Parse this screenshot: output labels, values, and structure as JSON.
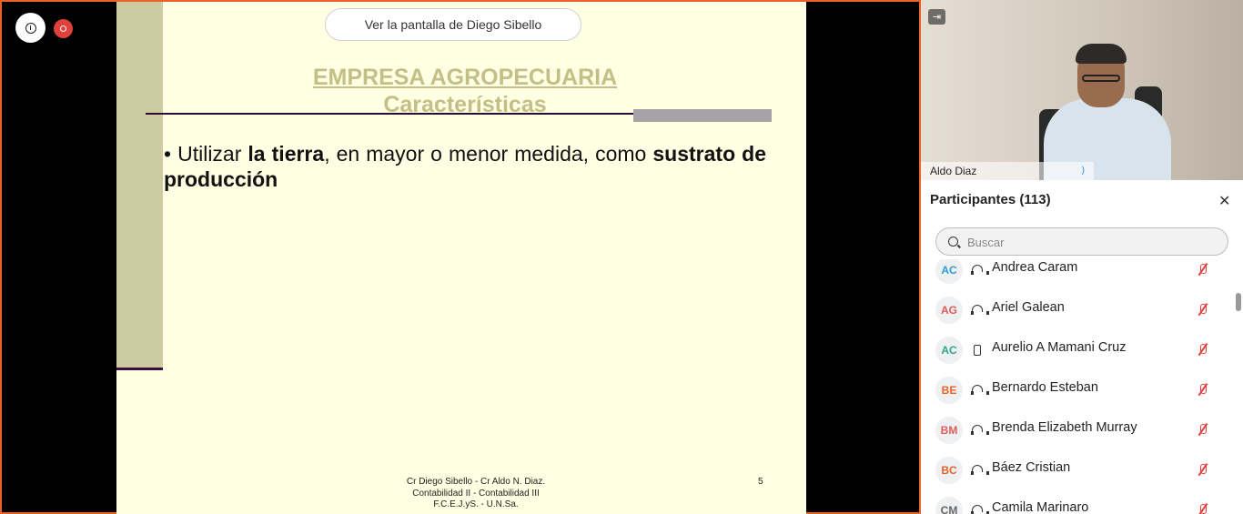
{
  "stage": {
    "view_label": "Ver la pantalla de Diego Sibello",
    "slide": {
      "title_line1": "EMPRESA AGROPECUARIA",
      "title_line2": "Características",
      "bullet_marker": "•",
      "bullet_t1": " Utilizar ",
      "bullet_b1": "la tierra",
      "bullet_t2": ", en mayor o menor medida, como ",
      "bullet_b2": "sustrato de producción",
      "footer_line1": "Cr Diego Sibello - Cr Aldo N. Diaz.",
      "footer_line2": "Contabilidad II  - Contabilidad III",
      "footer_line3": "F.C.E.J.yS.  - U.N.Sa.",
      "page_number": "5"
    }
  },
  "panel": {
    "video_name": "Aldo Diaz",
    "participants_title": "Participantes (113)",
    "search_placeholder": "Buscar",
    "participants": [
      {
        "initials": "AC",
        "name": "Andrea Caram",
        "color": "#2d9bd6",
        "device": "headset"
      },
      {
        "initials": "AG",
        "name": "Ariel Galean",
        "color": "#e05a5a",
        "device": "headset"
      },
      {
        "initials": "AC",
        "name": "Aurelio A Mamani Cruz",
        "color": "#2aa889",
        "device": "phone"
      },
      {
        "initials": "BE",
        "name": "Bernardo Esteban",
        "color": "#e8622a",
        "device": "headset"
      },
      {
        "initials": "BM",
        "name": "Brenda Elizabeth Murray",
        "color": "#e05a5a",
        "device": "headset"
      },
      {
        "initials": "BC",
        "name": "Báez Cristian",
        "color": "#e8622a",
        "device": "headset"
      },
      {
        "initials": "CM",
        "name": "Camila Marinaro",
        "color": "#666666",
        "device": "headset"
      }
    ]
  }
}
